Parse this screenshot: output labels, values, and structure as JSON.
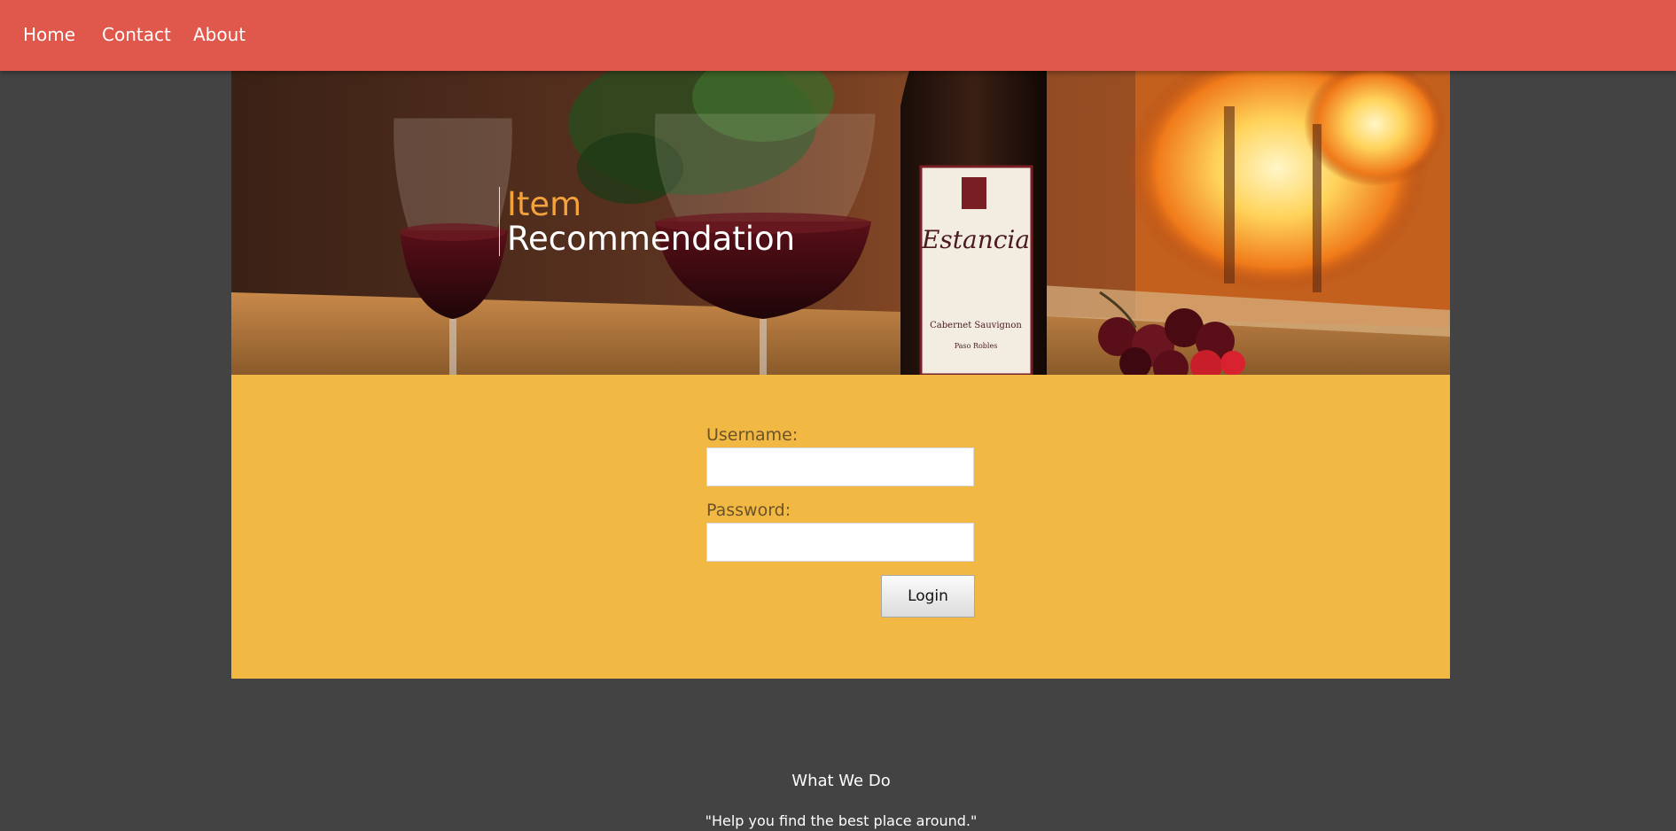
{
  "nav": {
    "home": "Home",
    "contact": "Contact",
    "about": "About"
  },
  "banner": {
    "title_line1": "Item",
    "title_line2": "Recommendation",
    "bottle_label": "Estancia",
    "bottle_sublabel": "Cabernet Sauvignon",
    "bottle_region": "Paso Robles"
  },
  "login": {
    "username_label": "Username:",
    "username_value": "",
    "password_label": "Password:",
    "password_value": "",
    "button_label": "Login"
  },
  "footer": {
    "title": "What We Do",
    "quote": "\"Help you find the best place around.\""
  },
  "colors": {
    "nav_bg": "#e0574c",
    "page_bg": "#434343",
    "panel_bg": "#f2b844",
    "accent": "#f2a33c"
  }
}
